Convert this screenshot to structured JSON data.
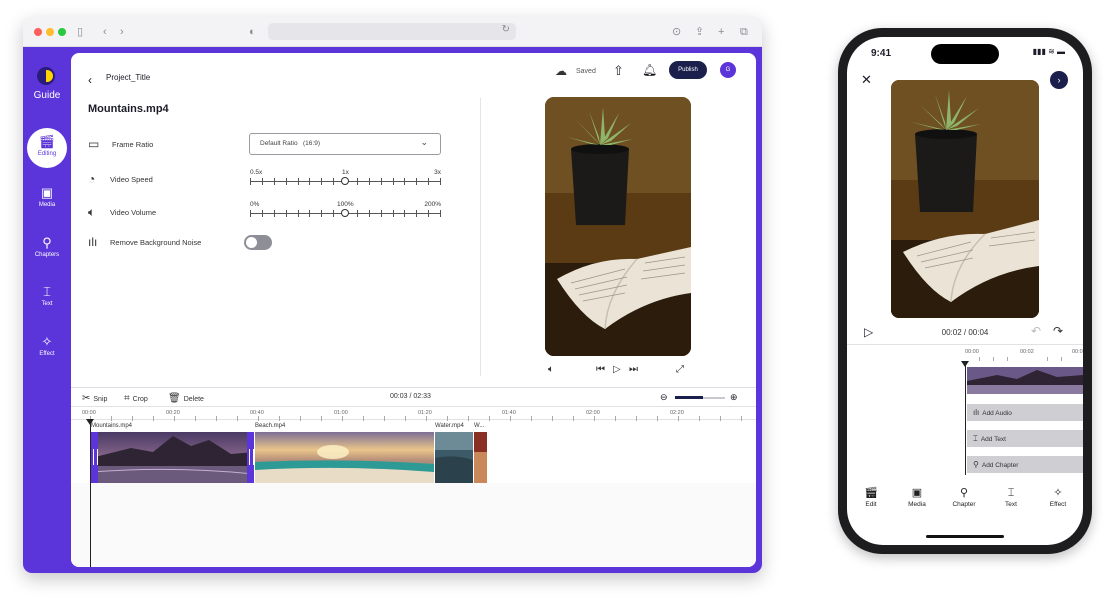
{
  "app": {
    "brand": "Guide",
    "project_title": "Project_Title",
    "file_name": "Mountains.mp4",
    "status": "Saved",
    "publish_label": "Publish",
    "avatar_initial": "G"
  },
  "sidebar": {
    "items": [
      {
        "label": "Editing",
        "icon": "clapperboard-icon",
        "active": true
      },
      {
        "label": "Media",
        "icon": "image-icon",
        "active": false
      },
      {
        "label": "Chapters",
        "icon": "pin-icon",
        "active": false
      },
      {
        "label": "Text",
        "icon": "text-icon",
        "active": false
      },
      {
        "label": "Effect",
        "icon": "magic-wand-icon",
        "active": false
      }
    ]
  },
  "settings": {
    "frame_ratio": {
      "label": "Frame Ratio",
      "value": "Default Ratio",
      "ratio": "(16:9)"
    },
    "video_speed": {
      "label": "Video Speed",
      "min": "0.5x",
      "mid": "1x",
      "max": "3x",
      "position": 0.5
    },
    "video_volume": {
      "label": "Video Volume",
      "min": "0%",
      "mid": "100%",
      "max": "200%",
      "position": 0.5
    },
    "remove_noise": {
      "label": "Remove Background Noise",
      "enabled": false
    }
  },
  "toolbar": {
    "snip": "Snip",
    "crop": "Crop",
    "delete": "Delete",
    "current_time": "00:03 / 02:33"
  },
  "timeline": {
    "ruler": [
      "00:00",
      "00:20",
      "00:40",
      "01:00",
      "01:20",
      "01:40",
      "02:00",
      "02:20"
    ],
    "clips": [
      {
        "name": "Mountains.mp4",
        "selected": true
      },
      {
        "name": "Beach.mp4",
        "selected": false
      },
      {
        "name": "Water.mp4",
        "selected": false
      },
      {
        "name": "W...",
        "selected": false
      }
    ]
  },
  "phone": {
    "clock": "9:41",
    "time": "00:02 / 00:04",
    "ruler": [
      "00:00",
      "00:02",
      "00:0"
    ],
    "tracks": [
      "Add Audio",
      "Add Text",
      "Add Chapter"
    ],
    "nav": [
      "Edit",
      "Media",
      "Chapter",
      "Text",
      "Effect"
    ]
  },
  "colors": {
    "brand_purple": "#5b35d9",
    "navy": "#1a1f4b",
    "accent_yellow": "#ffd400"
  }
}
